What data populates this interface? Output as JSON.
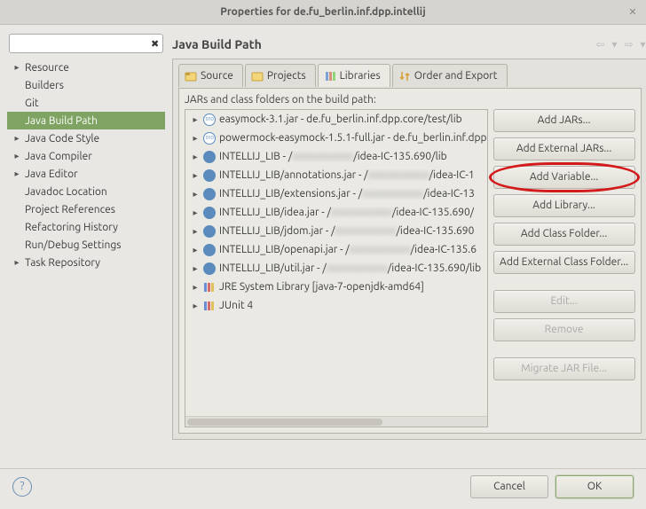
{
  "title": "Properties for de.fu_berlin.inf.dpp.intellij",
  "filter_placeholder": "",
  "categories": [
    {
      "label": "Resource",
      "hasChildren": true
    },
    {
      "label": "Builders",
      "hasChildren": false
    },
    {
      "label": "Git",
      "hasChildren": false
    },
    {
      "label": "Java Build Path",
      "hasChildren": false,
      "selected": true
    },
    {
      "label": "Java Code Style",
      "hasChildren": true
    },
    {
      "label": "Java Compiler",
      "hasChildren": true
    },
    {
      "label": "Java Editor",
      "hasChildren": true
    },
    {
      "label": "Javadoc Location",
      "hasChildren": false
    },
    {
      "label": "Project References",
      "hasChildren": false
    },
    {
      "label": "Refactoring History",
      "hasChildren": false
    },
    {
      "label": "Run/Debug Settings",
      "hasChildren": false
    },
    {
      "label": "Task Repository",
      "hasChildren": true
    }
  ],
  "page": {
    "title": "Java Build Path"
  },
  "tabs": [
    {
      "id": "source",
      "label": "Source"
    },
    {
      "id": "projects",
      "label": "Projects"
    },
    {
      "id": "libraries",
      "label": "Libraries",
      "active": true
    },
    {
      "id": "order",
      "label": "Order and Export"
    }
  ],
  "desc": "JARs and class folders on the build path:",
  "libs": [
    {
      "icon": "jar",
      "pre": "easymock-3.1.jar - de.fu_berlin.inf.dpp.core/test/lib",
      "blur": "",
      "post": ""
    },
    {
      "icon": "jar",
      "pre": "powermock-easymock-1.5.1-full.jar - de.fu_berlin.inf.dpp",
      "blur": "",
      "post": ""
    },
    {
      "icon": "var",
      "pre": "INTELLIJ_LIB - /",
      "blur": "xxxxxxxxxxx",
      "post": "/idea-IC-135.690/lib"
    },
    {
      "icon": "var",
      "pre": "INTELLIJ_LIB/annotations.jar - /",
      "blur": "xxxxxxxxxxx",
      "post": "/idea-IC-1"
    },
    {
      "icon": "var",
      "pre": "INTELLIJ_LIB/extensions.jar - /",
      "blur": "xxxxxxxxxxx",
      "post": "/idea-IC-13"
    },
    {
      "icon": "var",
      "pre": "INTELLIJ_LIB/idea.jar - /",
      "blur": "xxxxxxxxxxx",
      "post": "/idea-IC-135.690/"
    },
    {
      "icon": "var",
      "pre": "INTELLIJ_LIB/jdom.jar - /",
      "blur": "xxxxxxxxxxx",
      "post": "/idea-IC-135.690"
    },
    {
      "icon": "var",
      "pre": "INTELLIJ_LIB/openapi.jar - /",
      "blur": "xxxxxxxxxxx",
      "post": "/idea-IC-135.6"
    },
    {
      "icon": "var",
      "pre": "INTELLIJ_LIB/util.jar - /",
      "blur": "xxxxxxxxxxx",
      "post": "/idea-IC-135.690/lib"
    },
    {
      "icon": "libset",
      "pre": "JRE System Library [java-7-openjdk-amd64]",
      "blur": "",
      "post": ""
    },
    {
      "icon": "libset",
      "pre": "JUnit 4",
      "blur": "",
      "post": ""
    }
  ],
  "buttons": {
    "addJars": "Add JARs...",
    "addExtJars": "Add External JARs...",
    "addVar": "Add Variable...",
    "addLibrary": "Add Library...",
    "addClassFolder": "Add Class Folder...",
    "addExtClassFolder": "Add External Class Folder...",
    "edit": "Edit...",
    "remove": "Remove",
    "migrate": "Migrate JAR File..."
  },
  "dialog": {
    "cancel": "Cancel",
    "ok": "OK"
  },
  "highlight_button": "addVar"
}
